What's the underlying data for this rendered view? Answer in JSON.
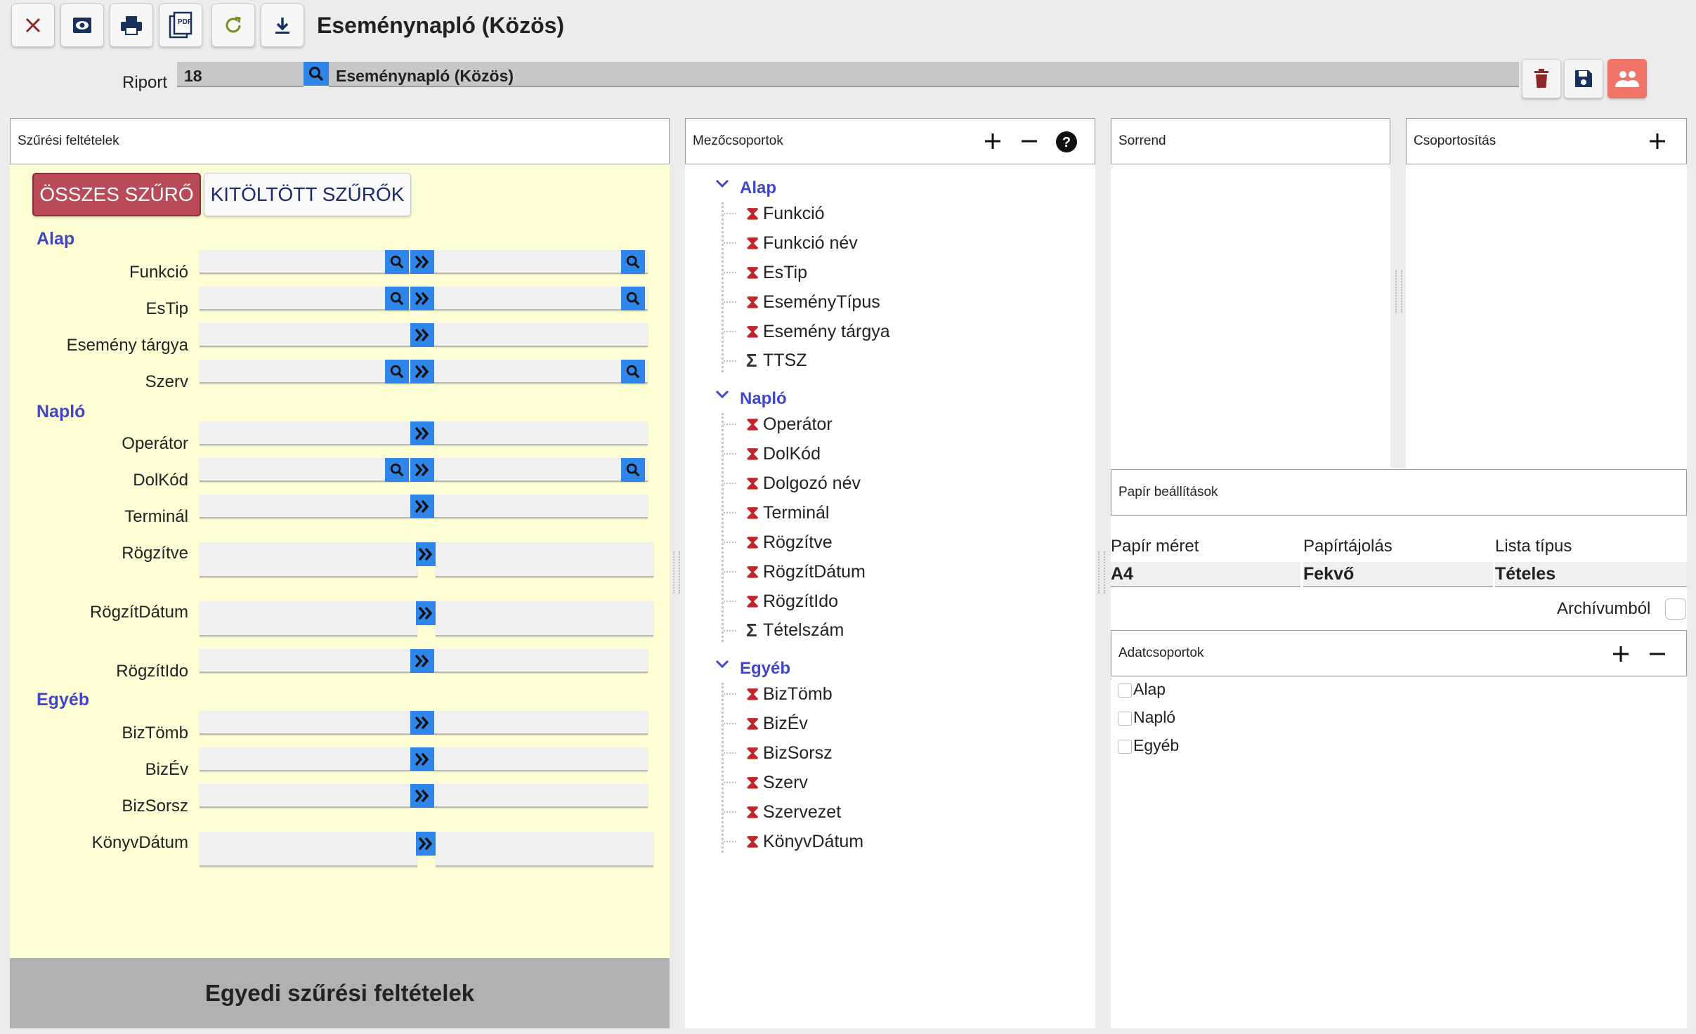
{
  "window": {
    "title": "Eseménynapló (Közös)"
  },
  "toolbar": {
    "icons": [
      "close-icon",
      "preview-eye-icon",
      "print-icon",
      "pdf-icon",
      "refresh-icon",
      "download-icon"
    ],
    "pdf_glyph": "PDF"
  },
  "riport": {
    "label": "Riport",
    "id": "18",
    "name": "Eseménynapló (Közös)"
  },
  "filters": {
    "header": "Szűrési feltételek",
    "tab_all": "ÖSSZES SZŰRŐ",
    "tab_filled": "KITÖLTÖTT SZŰRŐK",
    "groups": {
      "alap": "Alap",
      "naplo": "Napló",
      "egyeb": "Egyéb"
    },
    "fields": {
      "funkcio": "Funkció",
      "estip": "EsTip",
      "esemeny_targya": "Esemény tárgya",
      "szerv": "Szerv",
      "operator": "Operátor",
      "dolkod": "DolKód",
      "terminal": "Terminál",
      "rogzitve": "Rögzítve",
      "rogzitdatum": "RögzítDátum",
      "rogzitido": "RögzítIdo",
      "biztomb": "BizTömb",
      "bizev": "BizÉv",
      "bizsorsz": "BizSorsz",
      "konyvdatum": "KönyvDátum"
    },
    "footer": "Egyedi szűrési feltételek"
  },
  "mezocsoportok": {
    "header": "Mezőcsoportok",
    "groups": [
      {
        "name": "Alap",
        "items": [
          {
            "label": "Funkció",
            "sigma": "⧗"
          },
          {
            "label": "Funkció név",
            "sigma": "⧗"
          },
          {
            "label": "EsTip",
            "sigma": "⧗"
          },
          {
            "label": "EseményTípus",
            "sigma": "⧗"
          },
          {
            "label": "Esemény tárgya",
            "sigma": "⧗"
          },
          {
            "label": "TTSZ",
            "sigma": "Σ"
          }
        ]
      },
      {
        "name": "Napló",
        "items": [
          {
            "label": "Operátor",
            "sigma": "⧗"
          },
          {
            "label": "DolKód",
            "sigma": "⧗"
          },
          {
            "label": "Dolgozó név",
            "sigma": "⧗"
          },
          {
            "label": "Terminál",
            "sigma": "⧗"
          },
          {
            "label": "Rögzítve",
            "sigma": "⧗"
          },
          {
            "label": "RögzítDátum",
            "sigma": "⧗"
          },
          {
            "label": "RögzítIdo",
            "sigma": "⧗"
          },
          {
            "label": "Tételszám",
            "sigma": "Σ"
          }
        ]
      },
      {
        "name": "Egyéb",
        "items": [
          {
            "label": "BizTömb",
            "sigma": "⧗"
          },
          {
            "label": "BizÉv",
            "sigma": "⧗"
          },
          {
            "label": "BizSorsz",
            "sigma": "⧗"
          },
          {
            "label": "Szerv",
            "sigma": "⧗"
          },
          {
            "label": "Szervezet",
            "sigma": "⧗"
          },
          {
            "label": "KönyvDátum",
            "sigma": "⧗"
          }
        ]
      }
    ]
  },
  "sorrend": {
    "header": "Sorrend"
  },
  "csoportositas": {
    "header": "Csoportosítás"
  },
  "papir": {
    "header": "Papír beállítások",
    "meret_label": "Papír méret",
    "meret_value": "A4",
    "tajolas_label": "Papírtájolás",
    "tajolas_value": "Fekvő",
    "lista_label": "Lista típus",
    "lista_value": "Tételes",
    "archiv_label": "Archívumból"
  },
  "adatcsoportok": {
    "header": "Adatcsoportok",
    "items": [
      "Alap",
      "Napló",
      "Egyéb"
    ]
  },
  "colors": {
    "accent_blue": "#2f86ea",
    "group_blue": "#4146c9",
    "active_tab": "#b84b57",
    "filter_bg": "#ffffd5",
    "user_btn": "#f07468"
  }
}
